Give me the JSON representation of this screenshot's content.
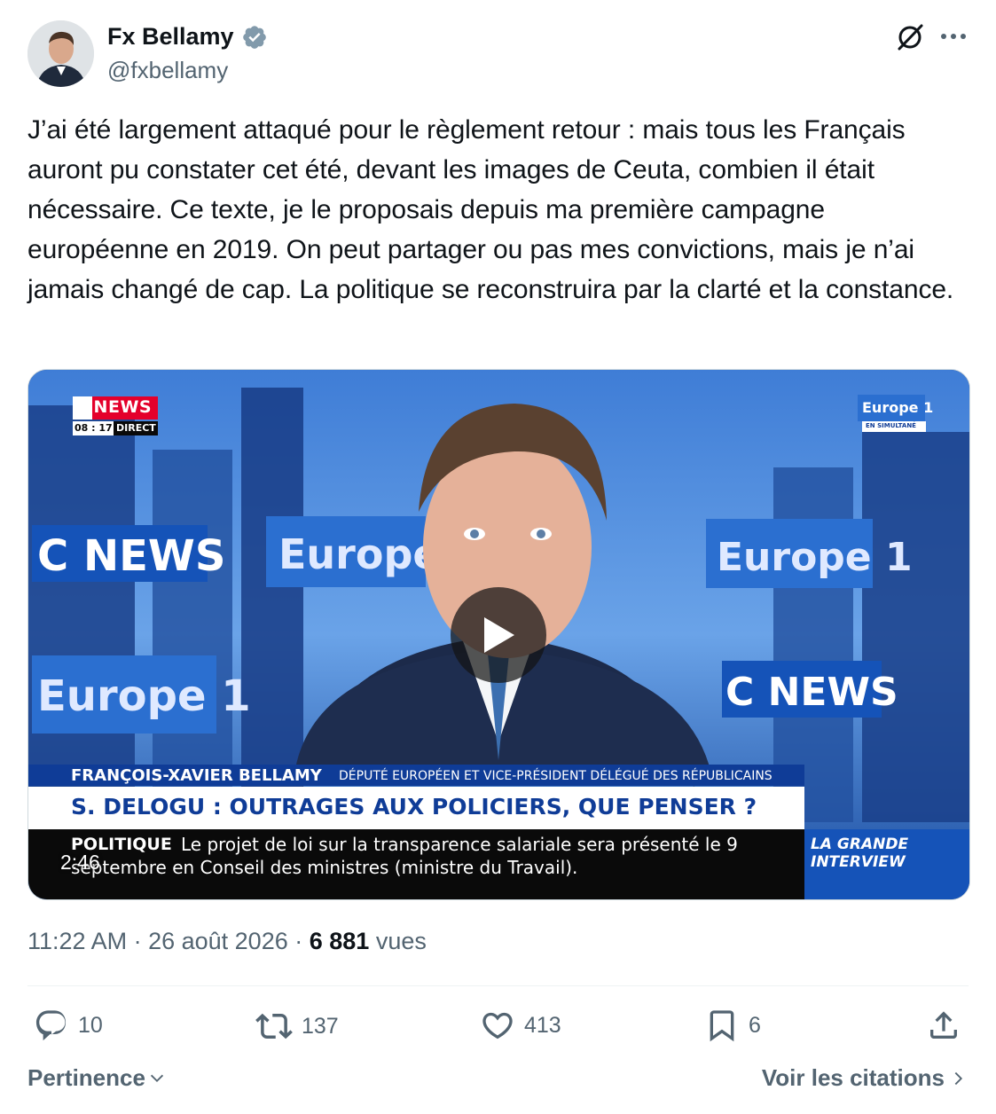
{
  "author": {
    "display_name": "Fx Bellamy",
    "handle": "@fxbellamy"
  },
  "tweet": {
    "text": "J’ai été largement attaqué pour le règlement retour : mais tous les Français auront pu constater cet été, devant les images de Ceuta, combien il était nécessaire. Ce texte, je le proposais depuis ma première campagne européenne en 2019. On peut partager ou pas mes convictions, mais je n’ai jamais changé de cap. La politique se reconstruira par la clarté et la constance."
  },
  "video": {
    "duration": "2:46",
    "overlay": {
      "cnews_logo": "C NEWS",
      "time": "08 : 17",
      "direct": "DIRECT",
      "europe1_logo": "Europe 1",
      "europe1_sub": "EN SIMULTANÉ",
      "guest_name": "FRANÇOIS-XAVIER BELLAMY",
      "guest_title": "DÉPUTÉ EUROPÉEN ET VICE-PRÉSIDENT DÉLÉGUÉ DES RÉPUBLICAINS",
      "headline": "S. DELOGU : OUTRAGES AUX POLICIERS, QUE PENSER ?",
      "ticker_tag": "POLITIQUE",
      "ticker_line1": "Le projet de loi sur la transparence salariale sera présenté le 9",
      "ticker_line2": "septembre en Conseil des ministres (ministre du Travail).",
      "show_name": "LA GRANDE INTERVIEW",
      "bg_wall_cnews": "C NEWS",
      "bg_wall_europe": "Europe 1"
    }
  },
  "meta": {
    "time": "11:22 AM",
    "separator": " · ",
    "date": "26 août 2026",
    "views_count": "6 881",
    "views_label": "vues"
  },
  "actions": {
    "replies": "10",
    "reposts": "137",
    "likes": "413",
    "bookmarks": "6"
  },
  "footer": {
    "sort_label": "Pertinence",
    "quotes_label": "Voir les citations"
  },
  "colors": {
    "text_primary": "#0f1419",
    "text_secondary": "#536471",
    "verified": "#829aab",
    "divider": "#eff3f4"
  }
}
